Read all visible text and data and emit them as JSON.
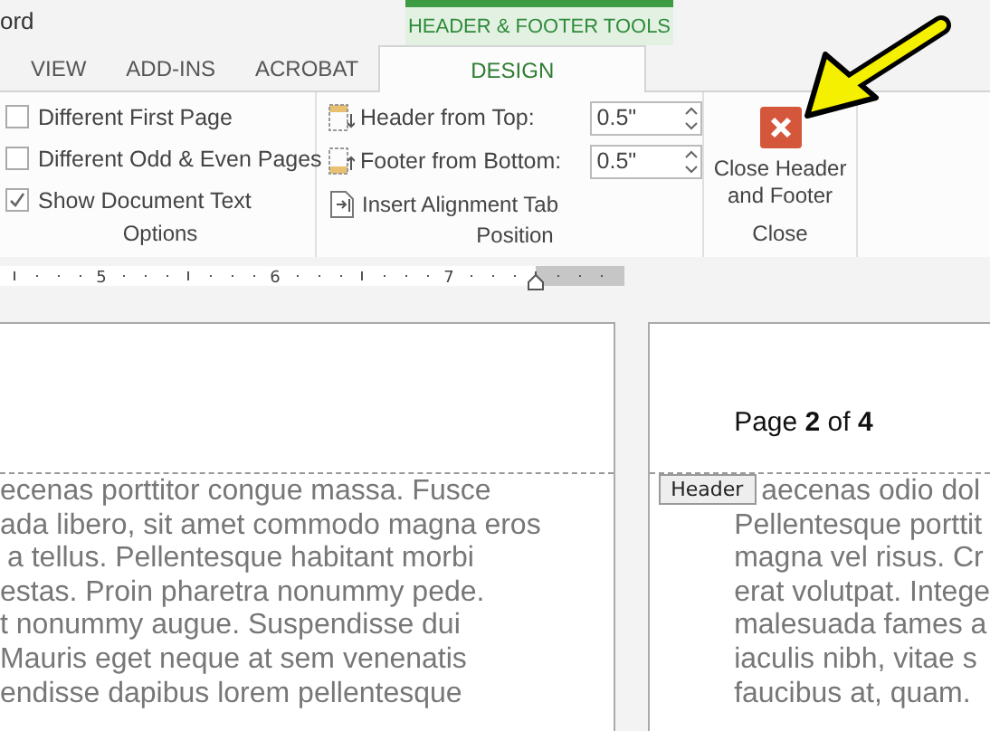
{
  "app_title": "ord",
  "contextual_tab": "HEADER & FOOTER TOOLS",
  "tabs": [
    {
      "label": "VIEW",
      "selected": false
    },
    {
      "label": "ADD-INS",
      "selected": false
    },
    {
      "label": "ACROBAT",
      "selected": false
    },
    {
      "label": "DESIGN",
      "selected": true
    }
  ],
  "options": {
    "label": "Options",
    "checkboxes": [
      {
        "label": "Different First Page",
        "checked": false
      },
      {
        "label": "Different Odd & Even Pages",
        "checked": false
      },
      {
        "label": "Show Document Text",
        "checked": true
      }
    ]
  },
  "position": {
    "label": "Position",
    "fields": [
      {
        "kind": "header",
        "label": "Header from Top:",
        "value": "0.5\""
      },
      {
        "kind": "footer",
        "label": "Footer from Bottom:",
        "value": "0.5\""
      }
    ],
    "insert_button": "Insert Alignment Tab"
  },
  "close": {
    "label": "Close",
    "button": "Close Header and Footer"
  },
  "ruler": {
    "numbers": [
      "5",
      "6",
      "7"
    ]
  },
  "left_page": {
    "lines": [
      "ecenas porttitor congue massa. Fusce",
      "ada libero, sit amet commodo magna eros",
      "a tellus. Pellentesque habitant morbi",
      "estas. Proin pharetra nonummy pede.",
      "t nonummy augue. Suspendisse dui",
      "Mauris eget neque at sem venenatis",
      "endisse dapibus lorem pellentesque"
    ]
  },
  "right_page": {
    "header_text": "Page **2** of **4**",
    "header_tag": "Header",
    "lines": [
      "aecenas odio dol",
      "Pellentesque porttit",
      "magna vel risus. Cr",
      "erat volutpat. Intege",
      "malesuada fames a",
      "iaculis nibh, vitae s",
      "faucibus at, quam."
    ]
  }
}
